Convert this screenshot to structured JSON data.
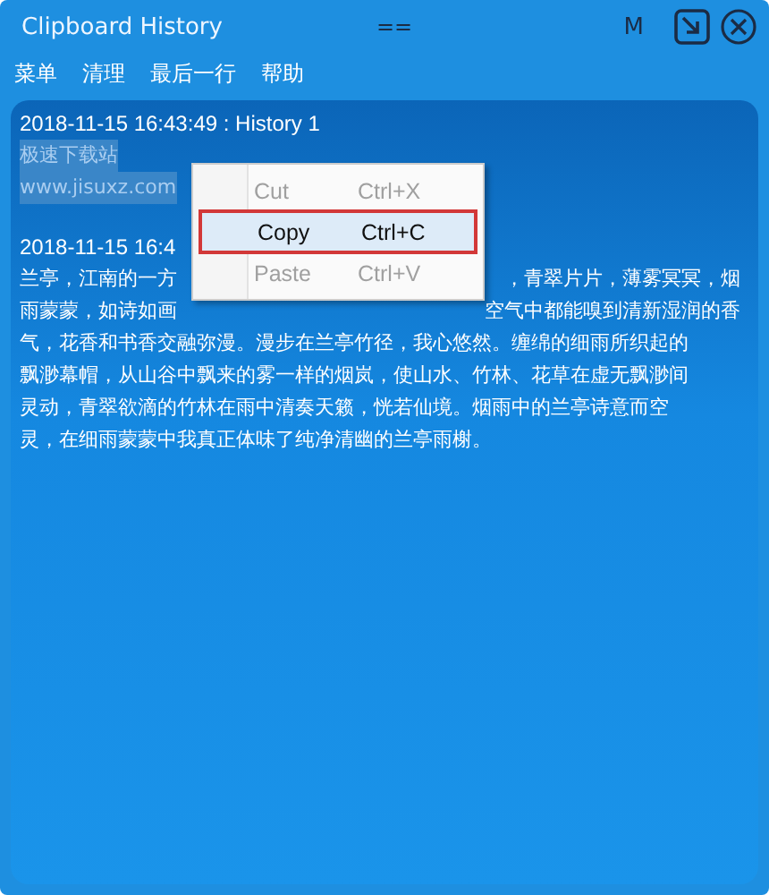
{
  "window": {
    "title": "Clipboard History",
    "center_mark": "==",
    "mode_label": "M"
  },
  "menu_bar": [
    "菜单",
    "清理",
    "最后一行",
    "帮助"
  ],
  "entries": [
    {
      "header": "2018-11-15 16:43:49 : History 1",
      "lines": [
        {
          "left": "极速下载站",
          "selected": true
        },
        {
          "left": "www.jisuxz.com",
          "selected": true
        }
      ]
    },
    {
      "header": "2018-11-15 16:4",
      "lines": [
        {
          "left": "兰亭，江南的一方",
          "right": "，青翠片片，薄雾冥冥，烟",
          "selected": false
        },
        {
          "left": "雨蒙蒙，如诗如画",
          "right": "空气中都能嗅到清新湿润的香",
          "selected": false
        },
        {
          "left": "气，花香和书香交融弥漫。漫步在兰亭竹径，我心悠然。缠绵的细雨所织起的",
          "selected": false
        },
        {
          "left": "飘渺幕帽，从山谷中飘来的雾一样的烟岚，使山水、竹林、花草在虚无飘渺间",
          "selected": false
        },
        {
          "left": "灵动，青翠欲滴的竹林在雨中清奏天籁，恍若仙境。烟雨中的兰亭诗意而空",
          "selected": false
        },
        {
          "left": "灵，在细雨蒙蒙中我真正体味了纯净清幽的兰亭雨榭。",
          "selected": false
        }
      ]
    }
  ],
  "context_menu": [
    {
      "label": "Cut",
      "shortcut": "Ctrl+X",
      "disabled": true,
      "highlighted": false
    },
    {
      "label": "Copy",
      "shortcut": "Ctrl+C",
      "disabled": false,
      "highlighted": true
    },
    {
      "label": "Paste",
      "shortcut": "Ctrl+V",
      "disabled": true,
      "highlighted": false
    }
  ]
}
